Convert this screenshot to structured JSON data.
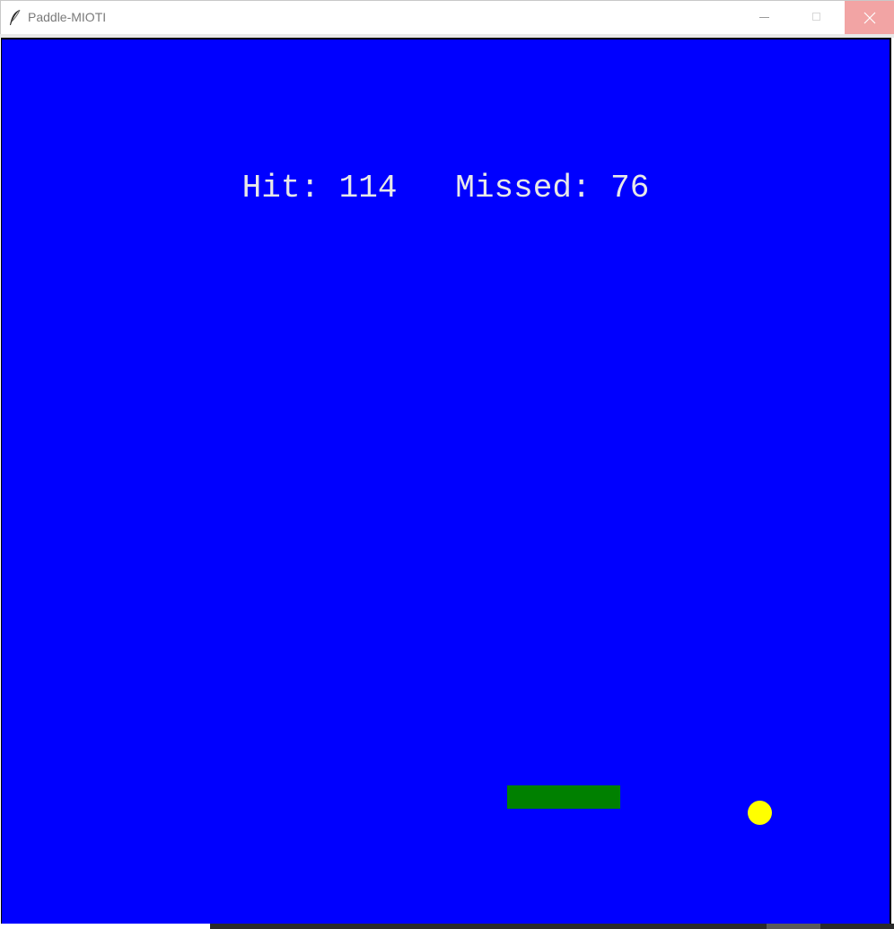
{
  "window": {
    "title": "Paddle-MIOTI",
    "app_icon": "feather-icon",
    "controls": {
      "minimize_icon": "minimize-icon",
      "maximize_icon": "maximize-icon",
      "close_icon": "close-icon",
      "close_hover_color": "#f2a4a4"
    }
  },
  "game": {
    "background_color": "#0000ff",
    "score_text": "Hit: 114   Missed: 76",
    "score": {
      "hit": 114,
      "missed": 76
    },
    "paddle_color": "#008000",
    "ball_color": "#ffff00",
    "text_color": "#e8e8e8"
  }
}
